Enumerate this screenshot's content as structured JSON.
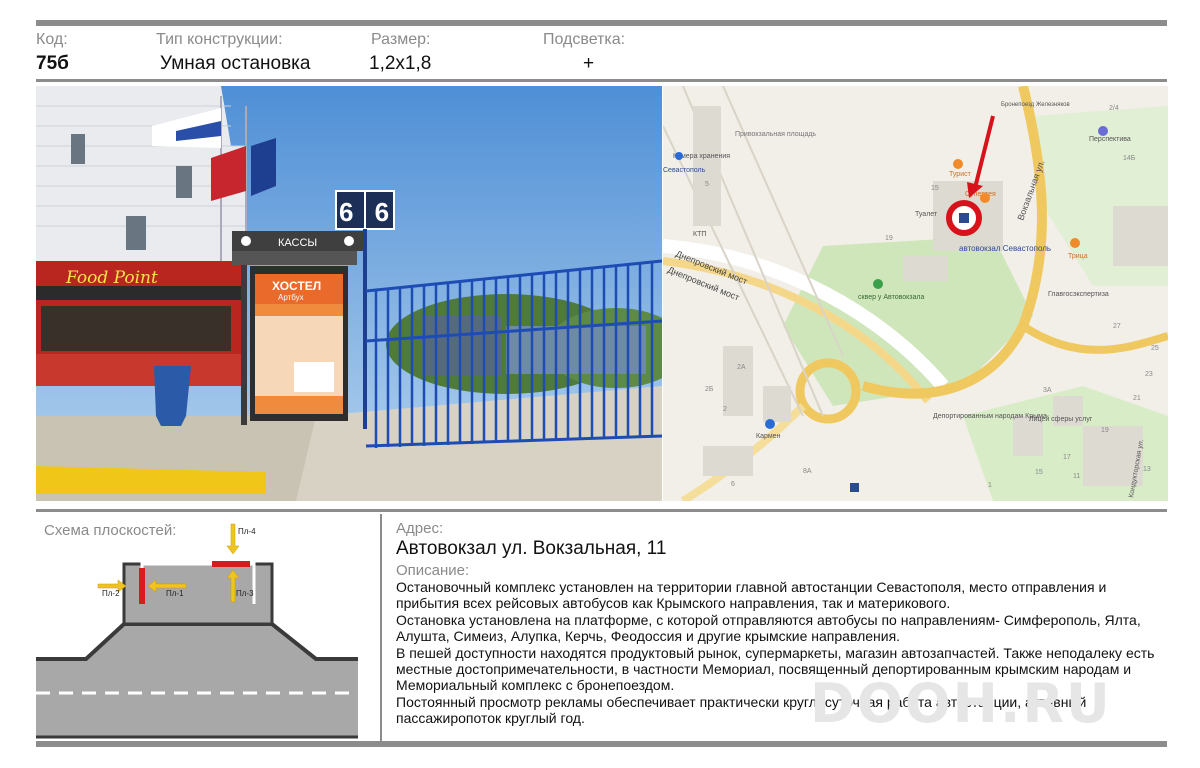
{
  "header": {
    "code_label": "Код:",
    "code_value": "75б",
    "type_label": "Тип конструкции:",
    "type_value": "Умная остановка",
    "size_label": "Размер:",
    "size_value": "1,2х1,8",
    "light_label": "Подсветка:",
    "light_value": "+"
  },
  "photo": {
    "cashier_sign": "КАССЫ",
    "platform_sign": "6 6",
    "cafe_sign": "Food Point",
    "ad_title": "ХОСТЕЛ",
    "ad_sub": "Артбух"
  },
  "map": {
    "labels": {
      "privokzal": "Привокзальная площадь",
      "kamera": "Камера хранения",
      "sevastopol": "Севастополь",
      "bronepoezd": "Бронепоезд Железняков",
      "perspektiva": "Перспектива",
      "turist": "Турист",
      "supertea": "Супертея",
      "tualet": "Туалет",
      "ktp": "КТП",
      "station": "автовокзал Севастополь",
      "vokzalnaya": "Вокзальная ул.",
      "dneprovsky1": "Днепровский мост",
      "dneprovsky2": "Днепровский мост",
      "tryca": "Трица",
      "glavgos": "Главгосэкспертиза",
      "skver": "сквер у Автовокзала",
      "deportirovannym": "Депортированным народам Крыма",
      "liceum": "Лицей сферы услуг",
      "karmen": "Кармен",
      "koduktor": "Кондукторская ул."
    },
    "house_numbers": [
      "2/4",
      "14Б",
      "15",
      "5",
      "19",
      "27",
      "2А",
      "2Б",
      "2",
      "8А",
      "6",
      "3А",
      "25",
      "23",
      "21",
      "19",
      "17",
      "15",
      "11",
      "13",
      "1"
    ]
  },
  "scheme": {
    "label": "Схема плоскостей:",
    "planes": [
      "Пл-4",
      "Пл-2",
      "Пл-1",
      "Пл-3"
    ]
  },
  "info": {
    "address_label": "Адрес:",
    "address_value": "Автовокзал ул. Вокзальная, 11",
    "desc_label": "Описание:",
    "desc_lines": [
      "Остановочный комплекс установлен на территории  главной автостанции Севастополя, место отправления и прибытия  всех рейсовых автобусов как Крымского направления, так и материкового.",
      " Остановка установлена на платформе, с которой отправляются автобусы по направлениям- Симферополь, Ялта, Алушта, Симеиз, Алупка, Керчь, Феодоссия и другие крымские направления.",
      "В пешей доступности находятся продуктовый рынок, супермаркеты, магазин автозапчастей. Также неподалеку есть местные достопримечательности, в частности Мемориал, посвященный депортированным крымским народам и Мемориальный комплекс с бронепоездом.",
      "Постоянный  просмотр рекламы обеспечивает практически круглосуточная работа автостанции, активный пассажиропоток круглый год."
    ]
  },
  "watermark": "DOOH.RU"
}
